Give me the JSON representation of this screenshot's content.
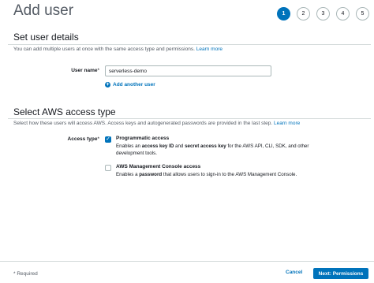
{
  "header": {
    "title": "Add user"
  },
  "steps": [
    "1",
    "2",
    "3",
    "4",
    "5"
  ],
  "details": {
    "title": "Set user details",
    "desc": "You can add multiple users at once with the same access type and permissions.",
    "learn_more": "Learn more",
    "user_name_label": "User name",
    "required_mark": "*",
    "user_name_value": "serverless-demo",
    "add_another": "Add another user"
  },
  "access": {
    "title": "Select AWS access type",
    "desc": "Select how these users will access AWS. Access keys and autogenerated passwords are provided in the last step.",
    "learn_more": "Learn more",
    "label": "Access type",
    "required_mark": "*",
    "options": [
      {
        "title": "Programmatic access",
        "checked": true,
        "desc_pre": "Enables an ",
        "b1": "access key ID",
        "mid": " and ",
        "b2": "secret access key",
        "desc_post": " for the AWS API, CLI, SDK, and other development tools."
      },
      {
        "title": "AWS Management Console access",
        "checked": false,
        "desc_pre": "Enables a ",
        "b1": "password",
        "desc_post": " that allows users to sign-in to the AWS Management Console."
      }
    ]
  },
  "footer": {
    "required_note": "* Required",
    "cancel": "Cancel",
    "next": "Next: Permissions"
  },
  "colors": {
    "accent": "#0073bb",
    "divider": "#d5dbdb"
  }
}
